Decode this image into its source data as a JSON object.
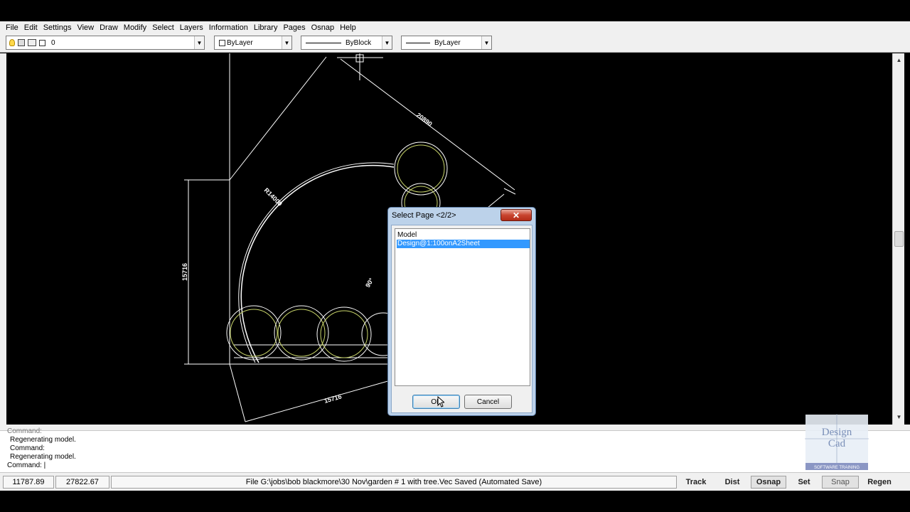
{
  "menu": [
    "File",
    "Edit",
    "Settings",
    "View",
    "Draw",
    "Modify",
    "Select",
    "Layers",
    "Information",
    "Library",
    "Pages",
    "Osnap",
    "Help"
  ],
  "toolbar": {
    "layer_value": "0",
    "color_value": "ByLayer",
    "linetype_value": "ByBlock",
    "lineweight_value": "ByLayer"
  },
  "drawing": {
    "dim_top": "20890",
    "dim_radius": "R14000",
    "dim_left": "15716",
    "dim_bottom": "15716",
    "dim_angle": "90°"
  },
  "dialog": {
    "title": "Select Page <2/2>",
    "close_label": "✕",
    "items": [
      "Model",
      "Design@1:100onA2Sheet"
    ],
    "selected_index": 1,
    "ok_label": "OK",
    "cancel_label": "Cancel"
  },
  "command": {
    "lines": [
      "Command:",
      "Regenerating model.",
      "Command:",
      "Regenerating model.",
      "Command: |"
    ]
  },
  "status": {
    "x": "11787.89",
    "y": "27822.67",
    "file_text": "File  G:\\jobs\\bob blackmore\\30 Nov\\garden # 1 with tree.Vec  Saved (Automated Save)",
    "buttons": [
      {
        "label": "Track",
        "pressed": false,
        "on": true
      },
      {
        "label": "Dist",
        "pressed": false,
        "on": true
      },
      {
        "label": "Osnap",
        "pressed": true,
        "on": true
      },
      {
        "label": "Set",
        "pressed": false,
        "on": true
      },
      {
        "label": "Snap",
        "pressed": true,
        "on": false
      },
      {
        "label": "Regen",
        "pressed": false,
        "on": true
      }
    ]
  },
  "watermark": {
    "line1": "Design",
    "line2": "Cad",
    "tagline": "SOFTWARE TRAINING"
  },
  "colors": {
    "canvas": "#000000",
    "selection": "#3399ff",
    "plant": "#c8d46a"
  }
}
